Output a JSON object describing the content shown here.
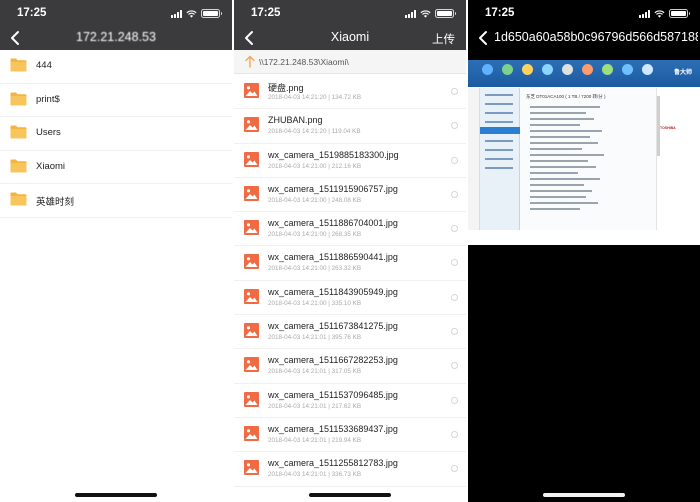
{
  "status_bar": {
    "time": "17:25"
  },
  "panel1": {
    "title": "172.21.248.53",
    "folders": [
      {
        "name": "444"
      },
      {
        "name": "print$"
      },
      {
        "name": "Users"
      },
      {
        "name": "Xiaomi"
      },
      {
        "name": "英雄时刻"
      }
    ]
  },
  "panel2": {
    "title": "Xiaomi",
    "upload_label": "上传",
    "path": "\\\\172.21.248.53\\Xiaomi\\",
    "files": [
      {
        "name": "硬盘.png",
        "meta": "2018-04-03 14:21:20 | 134.72 KB"
      },
      {
        "name": "ZHUBAN.png",
        "meta": "2018-04-03 14:21:20 | 119.04 KB"
      },
      {
        "name": "wx_camera_1519885183300.jpg",
        "meta": "2018-04-03 14:21:00 | 212.16 KB"
      },
      {
        "name": "wx_camera_1511915906757.jpg",
        "meta": "2018-04-03 14:21:00 | 248.08 KB"
      },
      {
        "name": "wx_camera_1511886704001.jpg",
        "meta": "2018-04-03 14:21:00 | 268.35 KB"
      },
      {
        "name": "wx_camera_1511886590441.jpg",
        "meta": "2018-04-03 14:21:00 | 263.32 KB"
      },
      {
        "name": "wx_camera_1511843905949.jpg",
        "meta": "2018-04-03 14:21:00 | 335.10 KB"
      },
      {
        "name": "wx_camera_1511673841275.jpg",
        "meta": "2018-04-03 14:21:01 | 395.76 KB"
      },
      {
        "name": "wx_camera_1511667282253.jpg",
        "meta": "2018-04-03 14:21:01 | 317.05 KB"
      },
      {
        "name": "wx_camera_1511537096485.jpg",
        "meta": "2018-04-03 14:21:01 | 217.62 KB"
      },
      {
        "name": "wx_camera_1511533689437.jpg",
        "meta": "2018-04-03 14:21:01 | 219.94 KB"
      },
      {
        "name": "wx_camera_1511255812783.jpg",
        "meta": "2018-04-03 14:21:01 | 336.73 KB"
      }
    ]
  },
  "panel3": {
    "title": "1d650a60a58b0c96796d566d587188c...",
    "image": {
      "brand_text": "鲁大师",
      "side_brand": "TOSHIBA",
      "header_text": "东芝 DT01ACA100 ( 1 TB / 7200 转/分 )"
    }
  },
  "colors": {
    "nav_bar": "#3b3b3d",
    "folder": "#f4b43e",
    "image_thumb": "#f06a43",
    "path_arrow": "#f5a55a"
  },
  "icons": {
    "back": "chevron-left-icon",
    "folder": "folder-icon",
    "image": "image-file-icon",
    "up": "arrow-up-icon",
    "signal": "cellular-signal-icon",
    "wifi": "wifi-icon",
    "battery": "battery-icon"
  }
}
